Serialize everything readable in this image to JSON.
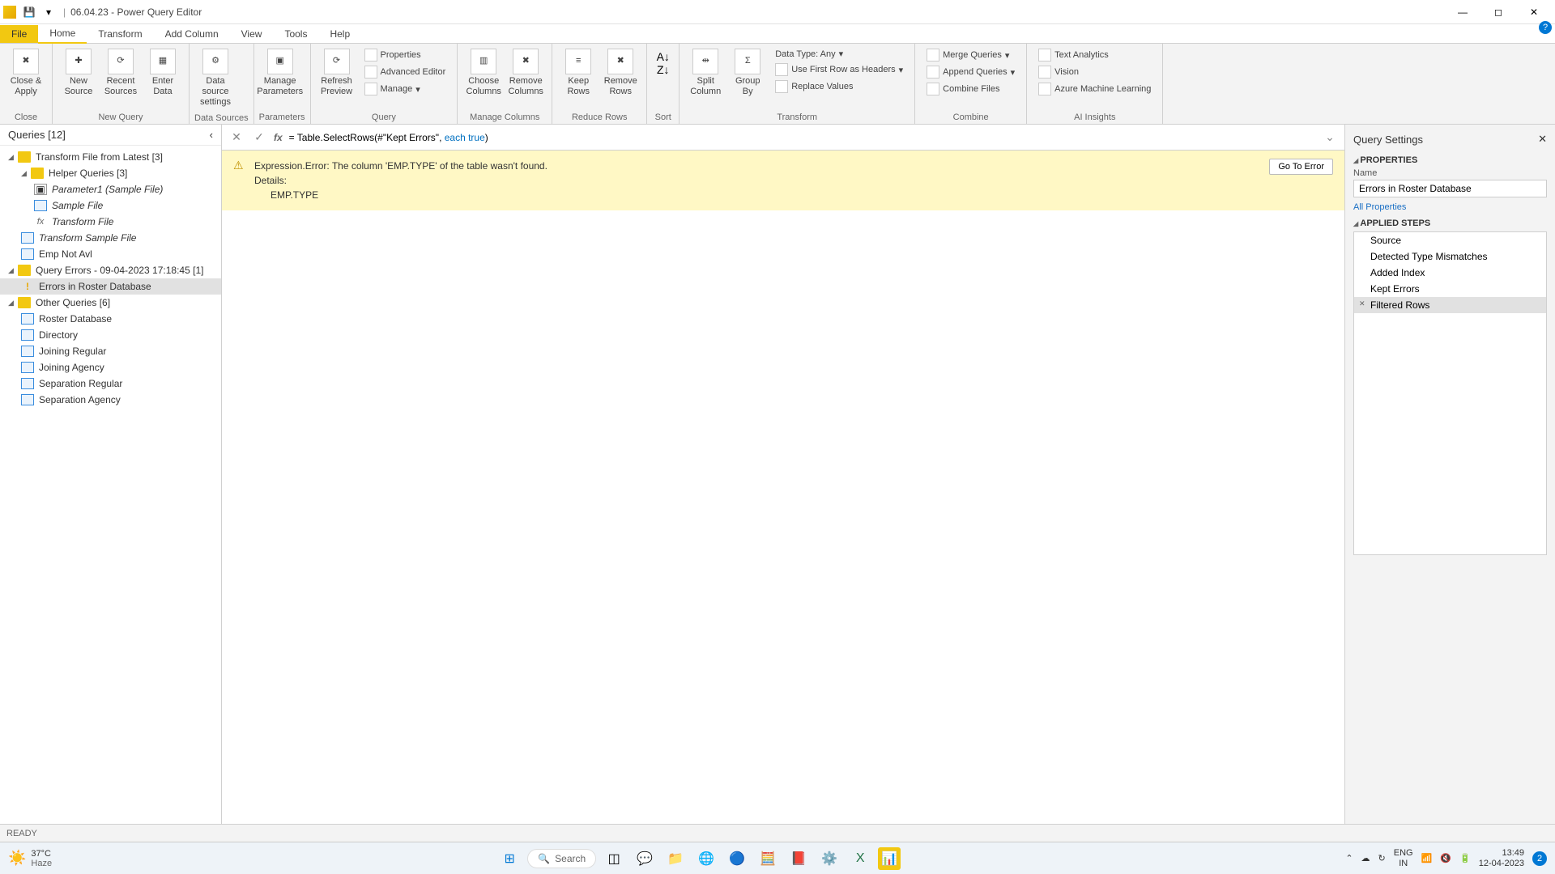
{
  "titlebar": {
    "title": "06.04.23 - Power Query Editor"
  },
  "menus": {
    "file": "File",
    "home": "Home",
    "transform": "Transform",
    "addcolumn": "Add Column",
    "view": "View",
    "tools": "Tools",
    "help": "Help"
  },
  "ribbon": {
    "close": {
      "label": "Close &\nApply",
      "group": "Close"
    },
    "newquery": {
      "new_source": "New\nSource",
      "recent_sources": "Recent\nSources",
      "enter_data": "Enter\nData",
      "group": "New Query"
    },
    "datasources": {
      "btn": "Data source\nsettings",
      "group": "Data Sources"
    },
    "parameters": {
      "btn": "Manage\nParameters",
      "group": "Parameters"
    },
    "query": {
      "refresh": "Refresh\nPreview",
      "properties": "Properties",
      "advanced": "Advanced Editor",
      "manage": "Manage",
      "group": "Query"
    },
    "managecols": {
      "choose": "Choose\nColumns",
      "remove": "Remove\nColumns",
      "group": "Manage Columns"
    },
    "reducerows": {
      "keep": "Keep\nRows",
      "remove": "Remove\nRows",
      "group": "Reduce Rows"
    },
    "sort": {
      "group": "Sort"
    },
    "transform": {
      "split": "Split\nColumn",
      "groupby": "Group\nBy",
      "datatype": "Data Type: Any",
      "firstrow": "Use First Row as Headers",
      "replace": "Replace Values",
      "group": "Transform"
    },
    "combine": {
      "merge": "Merge Queries",
      "append": "Append Queries",
      "files": "Combine Files",
      "group": "Combine"
    },
    "ai": {
      "text": "Text Analytics",
      "vision": "Vision",
      "azure": "Azure Machine Learning",
      "group": "AI Insights"
    }
  },
  "queries": {
    "header": "Queries [12]",
    "groups": [
      {
        "type": "folder",
        "level": 0,
        "label": "Transform File from Latest [3]",
        "expanded": true
      },
      {
        "type": "folder",
        "level": 1,
        "label": "Helper Queries [3]",
        "expanded": true
      },
      {
        "type": "param",
        "level": 2,
        "label": "Parameter1 (Sample File)",
        "italic": true
      },
      {
        "type": "table",
        "level": 2,
        "label": "Sample File",
        "italic": true
      },
      {
        "type": "fx",
        "level": 2,
        "label": "Transform File",
        "italic": true
      },
      {
        "type": "table",
        "level": 1,
        "label": "Transform Sample File",
        "italic": true
      },
      {
        "type": "table",
        "level": 1,
        "label": "Emp Not Avl"
      },
      {
        "type": "folder",
        "level": 0,
        "label": "Query Errors - 09-04-2023 17:18:45 [1]",
        "expanded": true
      },
      {
        "type": "err",
        "level": 1,
        "label": "Errors in Roster Database",
        "selected": true
      },
      {
        "type": "folder",
        "level": 0,
        "label": "Other Queries [6]",
        "expanded": true
      },
      {
        "type": "table",
        "level": 1,
        "label": "Roster Database"
      },
      {
        "type": "table",
        "level": 1,
        "label": "Directory"
      },
      {
        "type": "table",
        "level": 1,
        "label": "Joining Regular"
      },
      {
        "type": "table",
        "level": 1,
        "label": "Joining Agency"
      },
      {
        "type": "table",
        "level": 1,
        "label": "Separation Regular"
      },
      {
        "type": "table",
        "level": 1,
        "label": "Separation Agency"
      }
    ]
  },
  "formula": {
    "prefix": "= Table.SelectRows(",
    "str": "#\"Kept Errors\"",
    "mid": ", ",
    "kw": "each true",
    "suffix": ")"
  },
  "error": {
    "line1": "Expression.Error: The column 'EMP.TYPE' of the table wasn't found.",
    "line2": "Details:",
    "line3": "EMP.TYPE",
    "button": "Go To Error"
  },
  "settings": {
    "header": "Query Settings",
    "properties": "PROPERTIES",
    "name_label": "Name",
    "name_value": "Errors in Roster Database",
    "all_props": "All Properties",
    "applied": "APPLIED STEPS",
    "steps": [
      {
        "label": "Source"
      },
      {
        "label": "Detected Type Mismatches"
      },
      {
        "label": "Added Index"
      },
      {
        "label": "Kept Errors"
      },
      {
        "label": "Filtered Rows",
        "selected": true
      }
    ]
  },
  "status": {
    "ready": "READY"
  },
  "taskbar": {
    "temp": "37°C",
    "weather": "Haze",
    "search": "Search",
    "lang1": "ENG",
    "lang2": "IN",
    "time": "13:49",
    "date": "12-04-2023",
    "badge": "2"
  }
}
